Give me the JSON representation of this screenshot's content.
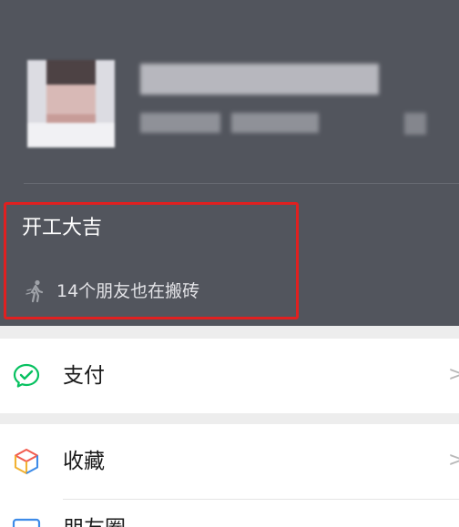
{
  "profile": {
    "status_title": "开工大吉",
    "friends_status": "14个朋友也在搬砖"
  },
  "menu": {
    "items": [
      {
        "label": "支付",
        "icon": "wechat-pay-icon",
        "chevron": ">",
        "color": "#07c160"
      },
      {
        "label": "收藏",
        "icon": "favorites-cube-icon",
        "chevron": ">",
        "color": "#f2b233"
      },
      {
        "label": "朋友圈",
        "icon": "moments-icon"
      }
    ]
  },
  "colors": {
    "header_bg": "#52555d",
    "highlight_border": "#e02020",
    "page_bg": "#ededed"
  }
}
